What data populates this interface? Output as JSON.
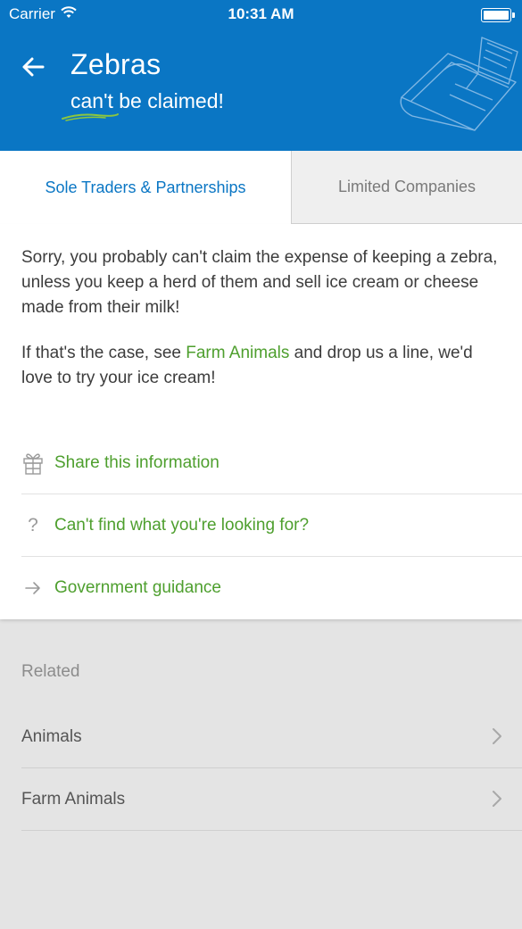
{
  "status_bar": {
    "carrier": "Carrier",
    "time": "10:31 AM"
  },
  "header": {
    "title": "Zebras",
    "subtitle": "can't be claimed!"
  },
  "tabs": [
    {
      "label": "Sole Traders & Partnerships",
      "active": true
    },
    {
      "label": "Limited Companies",
      "active": false
    }
  ],
  "body": {
    "paragraph1": "Sorry, you probably can't claim the expense of keeping a zebra, unless you keep a herd of them and sell ice cream or cheese made from their milk!",
    "paragraph2_before": "If that's the case, see ",
    "paragraph2_link": "Farm Animals",
    "paragraph2_after": " and drop us a line, we'd love to try your ice cream!"
  },
  "actions": [
    {
      "icon": "gift-icon",
      "label": "Share this information"
    },
    {
      "icon": "question-icon",
      "label": "Can't find what you're looking for?"
    },
    {
      "icon": "arrow-right-icon",
      "label": "Government guidance"
    }
  ],
  "related": {
    "heading": "Related",
    "items": [
      {
        "label": "Animals"
      },
      {
        "label": "Farm Animals"
      }
    ]
  },
  "colors": {
    "header_bg": "#0a76c4",
    "link_green": "#4e9f2e",
    "tab_active": "#0a76c4",
    "background": "#e4e4e4"
  }
}
